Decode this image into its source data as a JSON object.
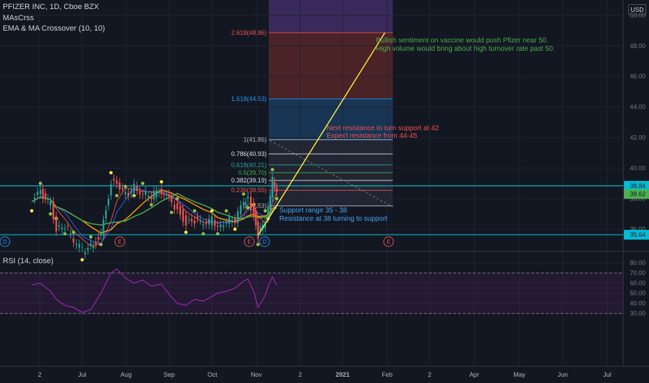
{
  "header": {
    "symbol_line": "PFIZER INC, 1D, Cboe BZX",
    "indicator_1": "MAsCrss",
    "indicator_2": "EMA & MA Crossover (10, 10)",
    "currency": "USD"
  },
  "colors": {
    "background": "#131722",
    "fib_ext_2618": "#ef5350",
    "fib_ext_1618": "#2196f3",
    "trendline": "#ffeb3b",
    "cyan_line": "#00bcd4",
    "rsi": "#9c27b0",
    "note_green": "#4caf50",
    "note_red": "#ef5350",
    "note_blue": "#42a5f5"
  },
  "annotations": {
    "bullish_1": "Bullish sentiment on vaccine would push Pfizer near 50.",
    "bullish_2": "High volume would bring about high turnover rate past 50.",
    "resist_1": "Next resistance to turn support at 42",
    "resist_2": "Expect resistance from 44-45",
    "support_1": "Support range 35 - 38",
    "support_2": "Resistance at 38 turning to support"
  },
  "rsi": {
    "title": "RSI (14, close)"
  },
  "chart_data": [
    {
      "type": "candlestick",
      "title": "PFIZER INC, 1D, Cboe BZX",
      "y_axis": {
        "min": 35,
        "max": 50,
        "ticks": [
          36.0,
          38.0,
          40.0,
          42.0,
          44.0,
          46.0,
          48.0,
          50.0
        ],
        "side": "right"
      },
      "x_ticks": [
        "2",
        "Jul",
        "Aug",
        "Sep",
        "Oct",
        "Nov",
        "2",
        "2021",
        "Feb",
        "2",
        "Apr",
        "May",
        "Jun",
        "Jul"
      ],
      "price_labels": [
        {
          "value": 38.84,
          "label": "38.84"
        },
        {
          "value": 38.62,
          "label": "38.62"
        },
        {
          "value": 35.64,
          "label": "35.64"
        }
      ],
      "horizontal_lines": [
        38.84,
        35.64
      ],
      "fibonacci": [
        {
          "label": "2.618(48.86)",
          "price": 48.86
        },
        {
          "label": "1.618(44.53)",
          "price": 44.53
        },
        {
          "label": "1(41.86)",
          "price": 41.86
        },
        {
          "label": "0.786(40.93)",
          "price": 40.93
        },
        {
          "label": "0.618(40.21)",
          "price": 40.21
        },
        {
          "label": "0.5(39.70)",
          "price": 39.7
        },
        {
          "label": "0.382(39.19)",
          "price": 39.19
        },
        {
          "label": "0.236(38.55)",
          "price": 38.55
        },
        {
          "label": "0(37.53)",
          "price": 37.53
        }
      ],
      "event_markers": [
        "D",
        "E",
        "E",
        "D",
        "E"
      ],
      "close_series": [
        {
          "date": "2020-05-26",
          "close": 37.8
        },
        {
          "date": "2020-06-01",
          "close": 38.4
        },
        {
          "date": "2020-06-08",
          "close": 37.6
        },
        {
          "date": "2020-06-12",
          "close": 36.1
        },
        {
          "date": "2020-06-18",
          "close": 36.3
        },
        {
          "date": "2020-06-24",
          "close": 35.2
        },
        {
          "date": "2020-06-30",
          "close": 34.6
        },
        {
          "date": "2020-07-06",
          "close": 34.9
        },
        {
          "date": "2020-07-13",
          "close": 35.6
        },
        {
          "date": "2020-07-20",
          "close": 39.1
        },
        {
          "date": "2020-07-24",
          "close": 38.8
        },
        {
          "date": "2020-07-30",
          "close": 38.2
        },
        {
          "date": "2020-08-05",
          "close": 38.8
        },
        {
          "date": "2020-08-11",
          "close": 38.4
        },
        {
          "date": "2020-08-17",
          "close": 38.2
        },
        {
          "date": "2020-08-24",
          "close": 38.5
        },
        {
          "date": "2020-08-31",
          "close": 37.7
        },
        {
          "date": "2020-09-04",
          "close": 37.4
        },
        {
          "date": "2020-09-10",
          "close": 36.4
        },
        {
          "date": "2020-09-16",
          "close": 36.6
        },
        {
          "date": "2020-09-22",
          "close": 36.3
        },
        {
          "date": "2020-09-28",
          "close": 36.6
        },
        {
          "date": "2020-10-02",
          "close": 36.3
        },
        {
          "date": "2020-10-08",
          "close": 36.6
        },
        {
          "date": "2020-10-14",
          "close": 36.6
        },
        {
          "date": "2020-10-20",
          "close": 37.7
        },
        {
          "date": "2020-10-23",
          "close": 38.0
        },
        {
          "date": "2020-10-27",
          "close": 37.0
        },
        {
          "date": "2020-10-30",
          "close": 35.6
        },
        {
          "date": "2020-11-04",
          "close": 36.6
        },
        {
          "date": "2020-11-06",
          "close": 37.3
        },
        {
          "date": "2020-11-09",
          "close": 39.3
        },
        {
          "date": "2020-11-12",
          "close": 38.6
        }
      ],
      "projection": {
        "from": {
          "date": "2020-10-30",
          "price": 35.6
        },
        "to": {
          "date": "2021-01-26",
          "price": 48.86
        }
      }
    },
    {
      "type": "line",
      "title": "RSI (14, close)",
      "y_axis": {
        "min": 30,
        "max": 80,
        "ticks": [
          30.0,
          40.0,
          50.0,
          60.0,
          70.0,
          80.0
        ]
      },
      "band": [
        30,
        70
      ],
      "series": [
        {
          "values": [
            {
              "date": "2020-05-26",
              "value": 58
            },
            {
              "date": "2020-06-01",
              "value": 60
            },
            {
              "date": "2020-06-08",
              "value": 52
            },
            {
              "date": "2020-06-12",
              "value": 44
            },
            {
              "date": "2020-06-18",
              "value": 38
            },
            {
              "date": "2020-06-24",
              "value": 36
            },
            {
              "date": "2020-06-30",
              "value": 31
            },
            {
              "date": "2020-07-06",
              "value": 34
            },
            {
              "date": "2020-07-13",
              "value": 50
            },
            {
              "date": "2020-07-20",
              "value": 70
            },
            {
              "date": "2020-07-24",
              "value": 74
            },
            {
              "date": "2020-07-30",
              "value": 65
            },
            {
              "date": "2020-08-05",
              "value": 60
            },
            {
              "date": "2020-08-11",
              "value": 63
            },
            {
              "date": "2020-08-17",
              "value": 57
            },
            {
              "date": "2020-08-24",
              "value": 59
            },
            {
              "date": "2020-08-31",
              "value": 46
            },
            {
              "date": "2020-09-04",
              "value": 40
            },
            {
              "date": "2020-09-10",
              "value": 38
            },
            {
              "date": "2020-09-16",
              "value": 44
            },
            {
              "date": "2020-09-22",
              "value": 42
            },
            {
              "date": "2020-09-28",
              "value": 47
            },
            {
              "date": "2020-10-02",
              "value": 50
            },
            {
              "date": "2020-10-08",
              "value": 52
            },
            {
              "date": "2020-10-14",
              "value": 55
            },
            {
              "date": "2020-10-20",
              "value": 62
            },
            {
              "date": "2020-10-23",
              "value": 64
            },
            {
              "date": "2020-10-27",
              "value": 52
            },
            {
              "date": "2020-10-30",
              "value": 36
            },
            {
              "date": "2020-11-04",
              "value": 48
            },
            {
              "date": "2020-11-06",
              "value": 57
            },
            {
              "date": "2020-11-09",
              "value": 66
            },
            {
              "date": "2020-11-12",
              "value": 58
            }
          ]
        }
      ]
    }
  ]
}
